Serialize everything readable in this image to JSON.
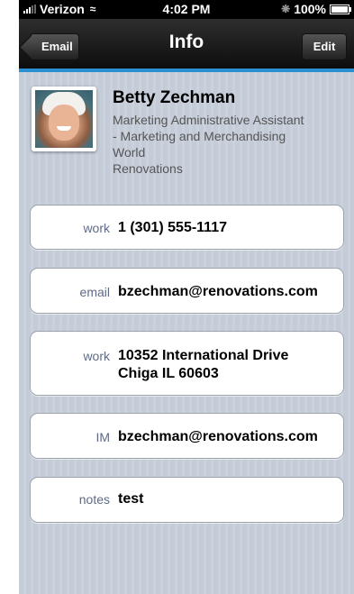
{
  "status_bar": {
    "carrier": "Verizon",
    "time": "4:02 PM",
    "battery": "100%"
  },
  "nav": {
    "back_label": "Email",
    "title": "Info",
    "edit_label": "Edit",
    "accent_color": "#2a8fd0"
  },
  "contact": {
    "name": "Betty Zechman",
    "title_lines": [
      "Marketing Administrative Assistant",
      "- Marketing and Merchandising",
      "World",
      "Renovations"
    ]
  },
  "fields": [
    {
      "label": "work",
      "lines": [
        "1 (301) 555-1117"
      ]
    },
    {
      "label": "email",
      "lines": [
        "bzechman@renovations.com"
      ]
    },
    {
      "label": "work",
      "lines": [
        "10352 International Drive",
        "Chiga IL 60603"
      ]
    },
    {
      "label": "IM",
      "lines": [
        "bzechman@renovations.com"
      ]
    },
    {
      "label": "notes",
      "lines": [
        "test"
      ]
    }
  ]
}
